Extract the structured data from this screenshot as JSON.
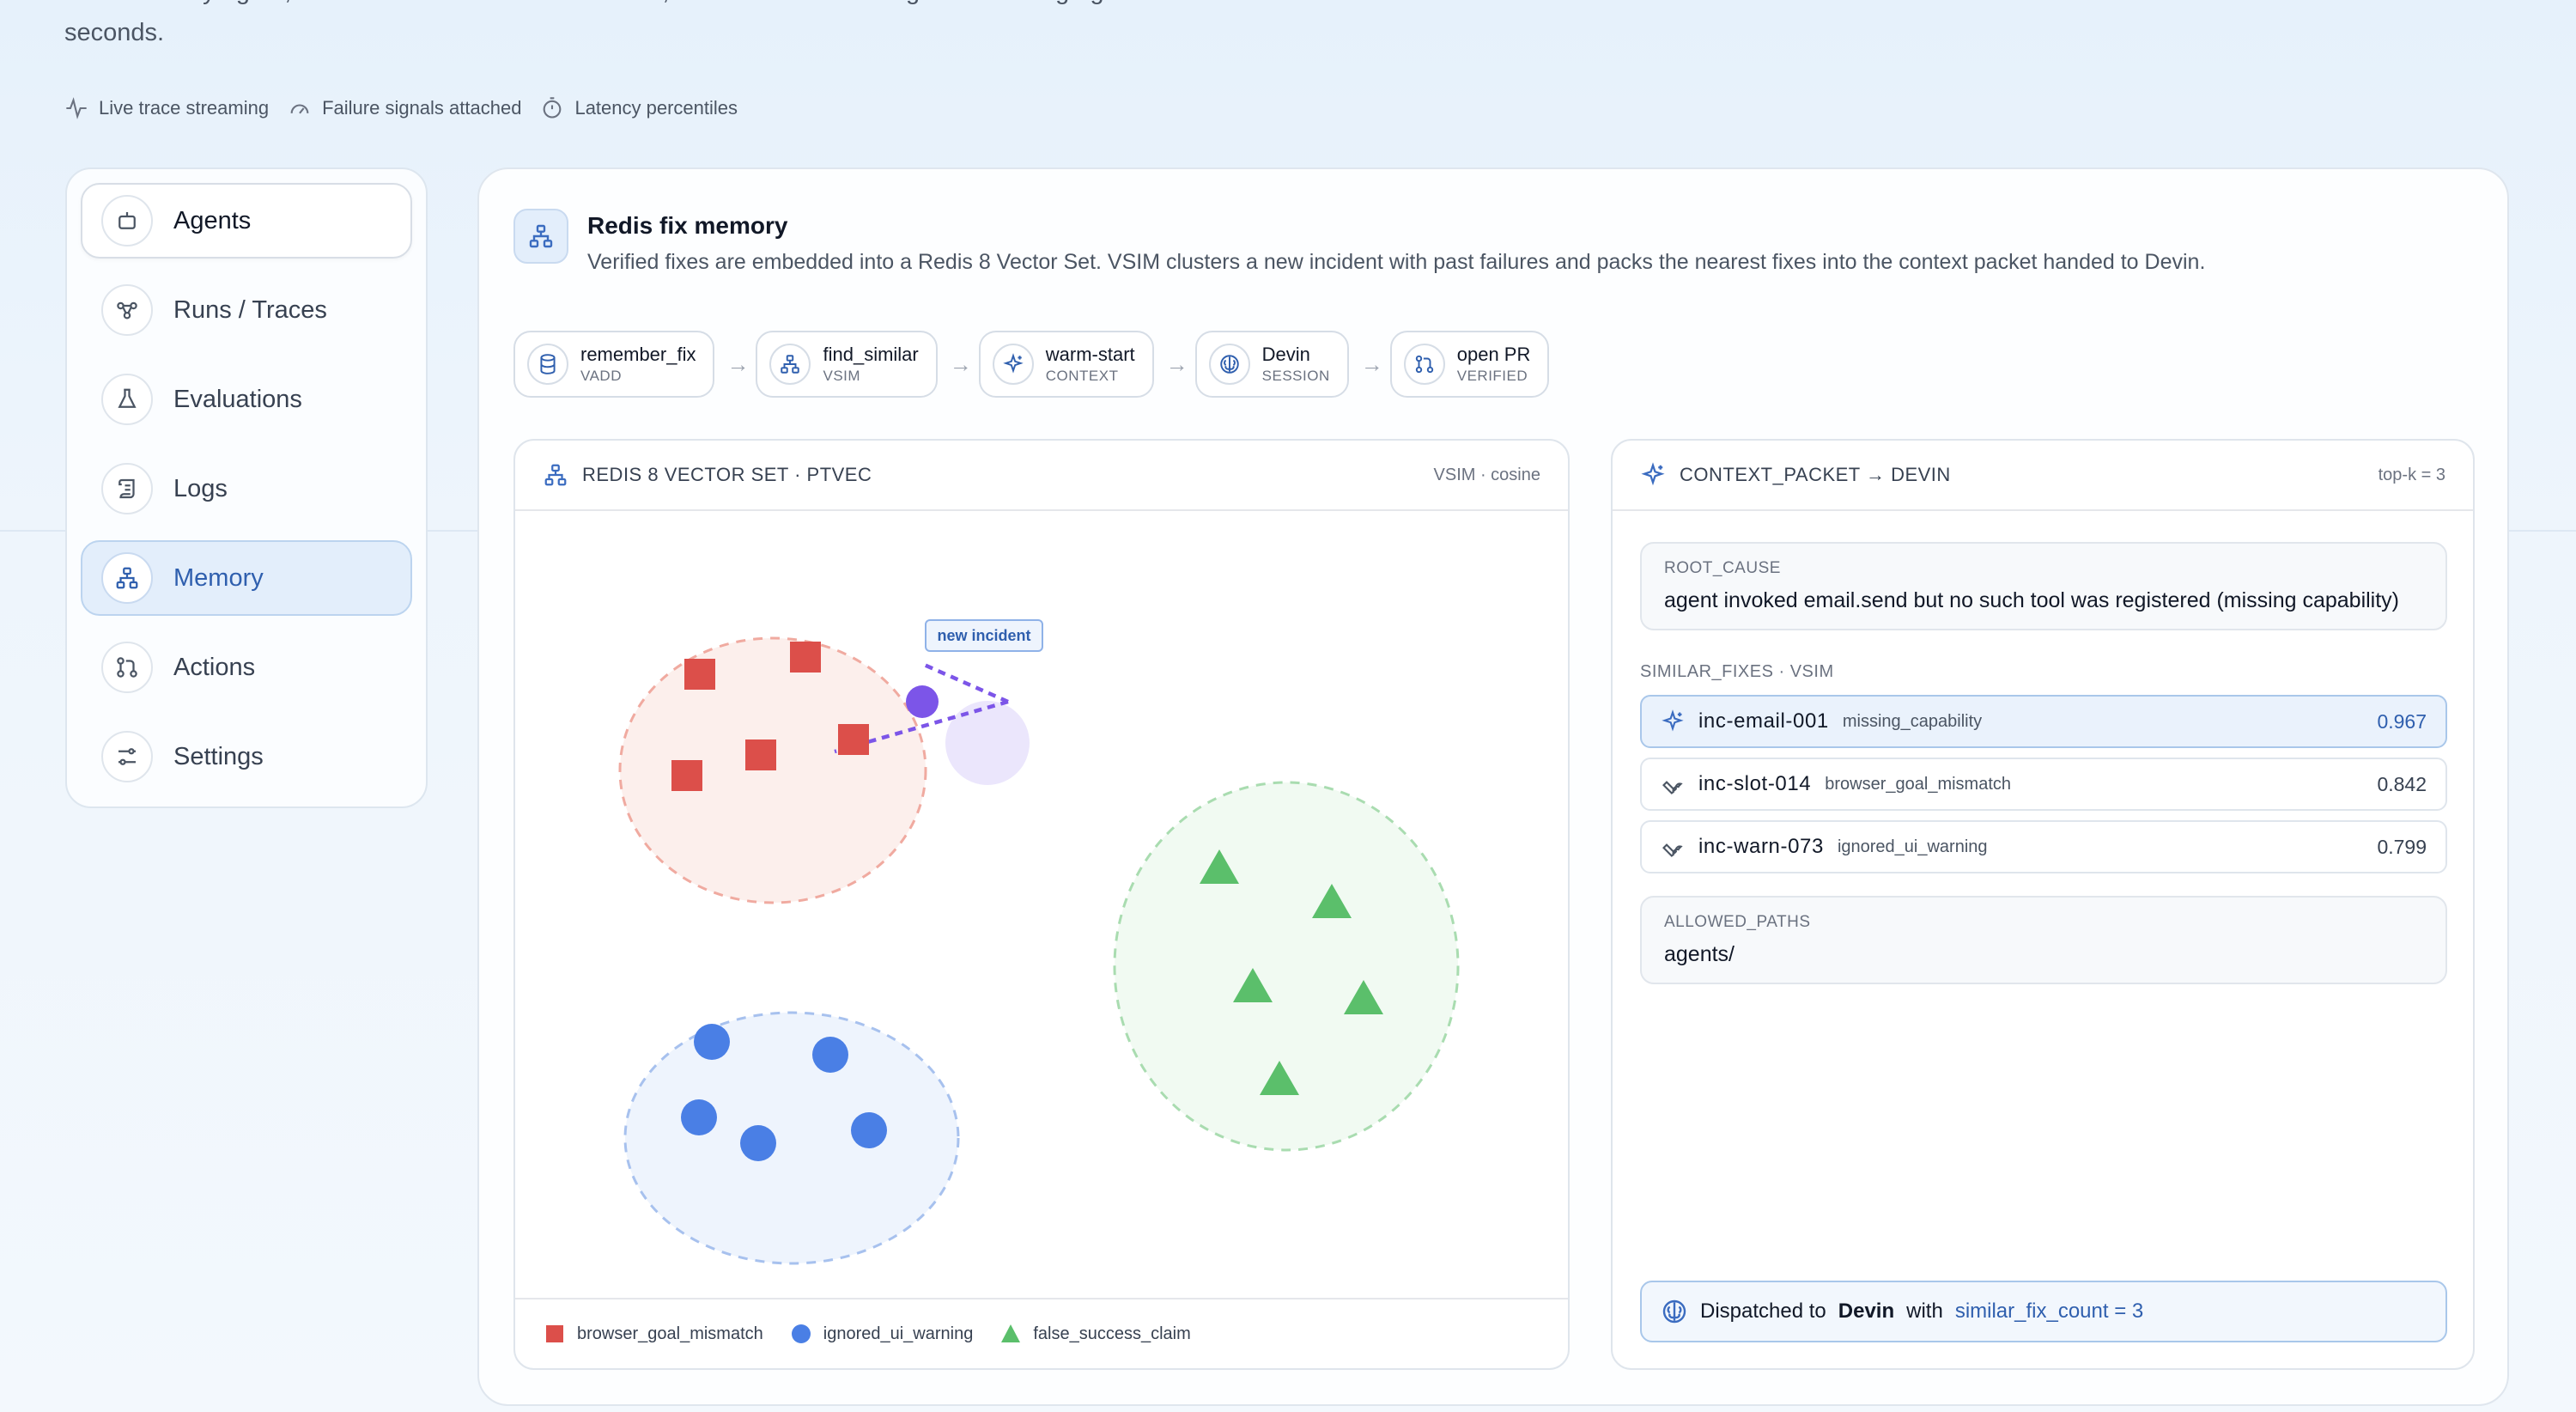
{
  "intro": "Monitor every agent, drill into runs and waterfall traces, and surface failure signals to debug agent failures in seconds.",
  "features": [
    {
      "icon": "pulse-icon",
      "label": "Live trace streaming"
    },
    {
      "icon": "gauge-icon",
      "label": "Failure signals attached"
    },
    {
      "icon": "timer-icon",
      "label": "Latency percentiles"
    }
  ],
  "sidebar": {
    "items": [
      {
        "label": "Agents",
        "icon": "bot-icon"
      },
      {
        "label": "Runs / Traces",
        "icon": "network-icon"
      },
      {
        "label": "Evaluations",
        "icon": "flask-icon"
      },
      {
        "label": "Logs",
        "icon": "scroll-icon"
      },
      {
        "label": "Memory",
        "icon": "hierarchy-icon"
      },
      {
        "label": "Actions",
        "icon": "git-pull-icon"
      },
      {
        "label": "Settings",
        "icon": "sliders-icon"
      }
    ],
    "active": "Memory"
  },
  "panel": {
    "title": "Redis fix memory",
    "description": "Verified fixes are embedded into a Redis 8 Vector Set. VSIM clusters a new incident with past failures and packs the nearest fixes into the context packet handed to Devin."
  },
  "pipeline": [
    {
      "name": "remember_fix",
      "sub": "VADD",
      "icon": "database-icon"
    },
    {
      "name": "find_similar",
      "sub": "VSIM",
      "icon": "hierarchy-icon"
    },
    {
      "name": "warm-start",
      "sub": "CONTEXT",
      "icon": "sparkle-icon"
    },
    {
      "name": "Devin",
      "sub": "SESSION",
      "icon": "brain-icon"
    },
    {
      "name": "open PR",
      "sub": "VERIFIED",
      "icon": "git-pull-icon"
    }
  ],
  "vector_card": {
    "title": "REDIS 8 VECTOR SET · PTVEC",
    "meta": "VSIM · cosine",
    "new_incident_label": "new incident",
    "legend": [
      {
        "label": "browser_goal_mismatch",
        "color": "#dc4f4a",
        "shape": "square"
      },
      {
        "label": "ignored_ui_warning",
        "color": "#4a7fe5",
        "shape": "circle"
      },
      {
        "label": "false_success_claim",
        "color": "#5bbf6b",
        "shape": "triangle"
      }
    ]
  },
  "context_card": {
    "title": "CONTEXT_PACKET → DEVIN",
    "meta": "top-k = 3",
    "root_cause_label": "ROOT_CAUSE",
    "root_cause": "agent invoked email.send but no such tool was registered (missing capability)",
    "similar_label": "SIMILAR_FIXES · VSIM",
    "fixes": [
      {
        "id": "inc-email-001",
        "tag": "missing_capability",
        "score": "0.967"
      },
      {
        "id": "inc-slot-014",
        "tag": "browser_goal_mismatch",
        "score": "0.842"
      },
      {
        "id": "inc-warn-073",
        "tag": "ignored_ui_warning",
        "score": "0.799"
      }
    ],
    "paths_label": "ALLOWED_PATHS",
    "paths": "agents/",
    "dispatch_prefix": "Dispatched to",
    "dispatch_target": "Devin",
    "dispatch_mid": "with",
    "dispatch_code": "similar_fix_count = 3"
  }
}
